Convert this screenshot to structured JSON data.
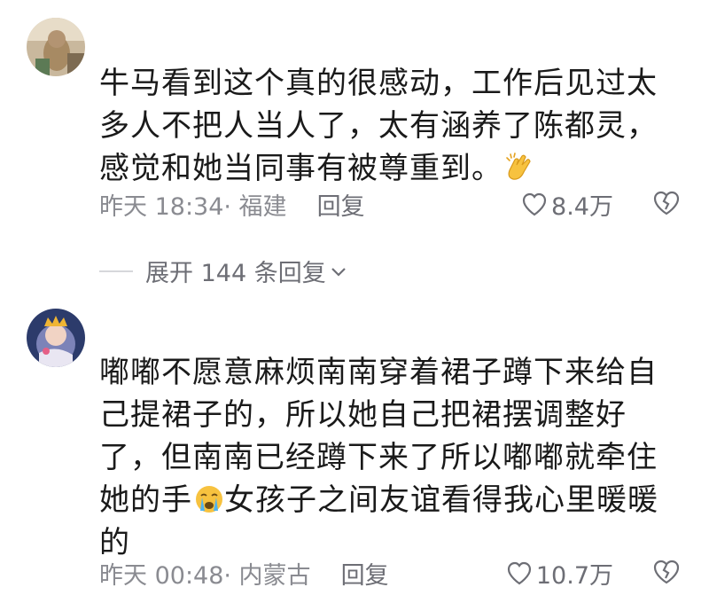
{
  "comments": [
    {
      "text": "牛马看到这个真的很感动，工作后见过太\n多人不把人当人了，太有涵养了陈都灵，\n感觉和她当同事有被尊重到。",
      "emoji": "clapping-hands-emoji",
      "time_location": "昨天 18:34· 福建",
      "reply_label": "回复",
      "likes": "8.4万"
    },
    {
      "text_before": "嘟嘟不愿意麻烦南南穿着裙子蹲下来给自\n己提裙子的，所以她自己把裙摆调整好\n了，但南南已经蹲下来了所以嘟嘟就牵住\n她的手",
      "emoji": "crying-face-emoji",
      "text_after": "女孩子之间友谊看得我心里暖暖\n的",
      "time_location": "昨天 00:48· 内蒙古",
      "reply_label": "回复",
      "likes": "10.7万"
    }
  ],
  "expand_replies_label": "展开 144 条回复"
}
